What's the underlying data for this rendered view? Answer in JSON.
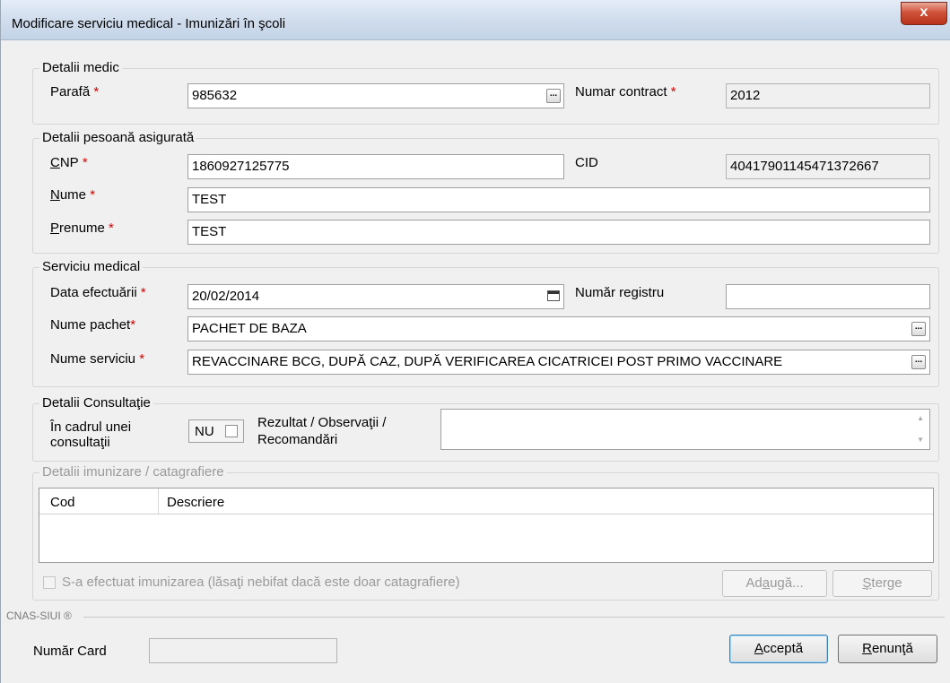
{
  "window": {
    "title": "Modificare serviciu medical - Imunizări în şcoli",
    "close_label": "x"
  },
  "detalii_medic": {
    "legend": "Detalii medic",
    "parafa_label": "Parafă",
    "parafa_value": "985632",
    "contract_label": "Numar contract",
    "contract_value": "2012"
  },
  "detalii_persoana": {
    "legend": "Detalii pesoană asigurată",
    "cnp_label_first": "C",
    "cnp_label_rest": "NP",
    "cnp_value": "1860927125775",
    "cid_label": "CID",
    "cid_value": "40417901145471372667",
    "nume_label_first": "N",
    "nume_label_rest": "ume",
    "nume_value": "TEST",
    "prenume_label_first": "P",
    "prenume_label_rest": "renume",
    "prenume_value": "TEST"
  },
  "serviciu_medical": {
    "legend": "Serviciu medical",
    "data_label": "Data efectuării",
    "data_value": "20/02/2014",
    "registru_label": "Număr registru",
    "registru_value": "",
    "pachet_label": "Nume pachet",
    "pachet_value": "PACHET DE BAZA",
    "serviciu_label": "Nume serviciu",
    "serviciu_value": "REVACCINARE BCG, DUPĂ CAZ, DUPĂ VERIFICAREA CICATRICEI POST PRIMO VACCINARE"
  },
  "detalii_consultatie": {
    "legend": "Detalii Consultaţie",
    "cadru_label_1": "În cadrul unei",
    "cadru_label_2": "consultaţii",
    "nu_value": "NU",
    "rezultat_label_1": "Rezultat / Observaţii /",
    "rezultat_label_2": "Recomandări"
  },
  "detalii_imunizare": {
    "legend": "Detalii imunizare / catagrafiere",
    "columns": [
      "Cod",
      "Descriere"
    ],
    "checkbox_label": "S-a efectuat imunizarea (lăsaţi nebifat dacă este doar catagrafiere)",
    "adauga_first": "Ad",
    "adauga_u": "a",
    "adauga_rest": "ugă...",
    "sterge_u": "Ş",
    "sterge_rest": "terge"
  },
  "footer": {
    "cnas_label": "CNAS-SIUI ®",
    "card_label": "Număr Card",
    "card_value": "",
    "accepta_u": "A",
    "accepta_rest": "cceptă",
    "renunta_u": "R",
    "renunta_rest": "enunţă"
  },
  "required_mark": "*",
  "icons": {
    "ellipsis": "...",
    "calendar": "calendar-icon",
    "scroll_up": "▲",
    "scroll_down": "▼"
  }
}
